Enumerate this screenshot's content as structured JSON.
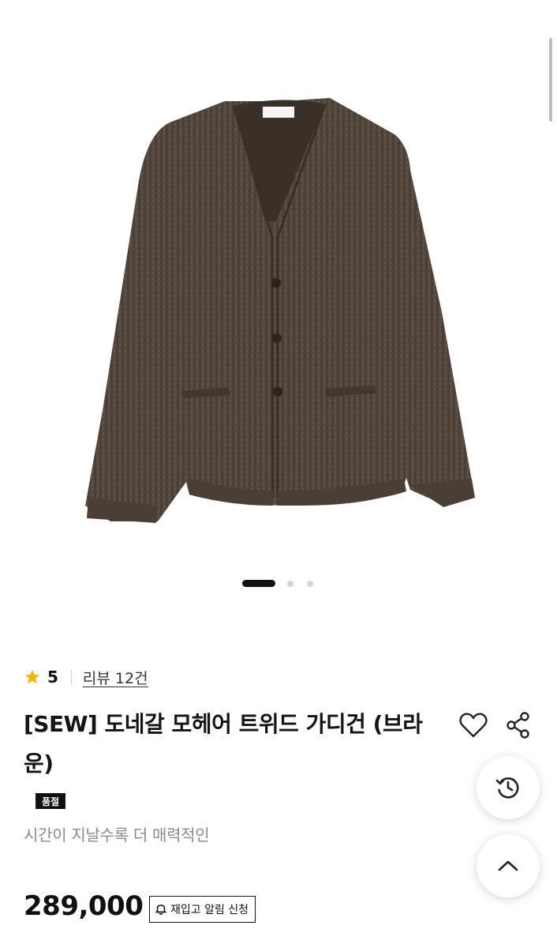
{
  "product": {
    "image_alt": "dark brown ribbed mohair tweed V-neck cardigan with buttons and two pockets",
    "image_index": 1,
    "image_count": 3,
    "rating": "5",
    "review_label": "리뷰 12건",
    "title": "[SEW] 도네갈 모헤어 트위드 가디건 (브라운)",
    "badge": "품절",
    "subtitle": "시간이 지날수록 더 매력적인",
    "price": "289,000",
    "restock_label": "재입고 알림 신청"
  },
  "icons": {
    "star": "star-icon",
    "wishlist": "heart-icon",
    "share": "share-icon",
    "restock": "bell-icon",
    "history": "history-icon",
    "scroll_top": "chevron-up-icon"
  },
  "colors": {
    "star": "#F5B50A",
    "badge_bg": "#111111",
    "subtitle": "#8A8A8A",
    "cardigan": "#5A4B3F"
  }
}
